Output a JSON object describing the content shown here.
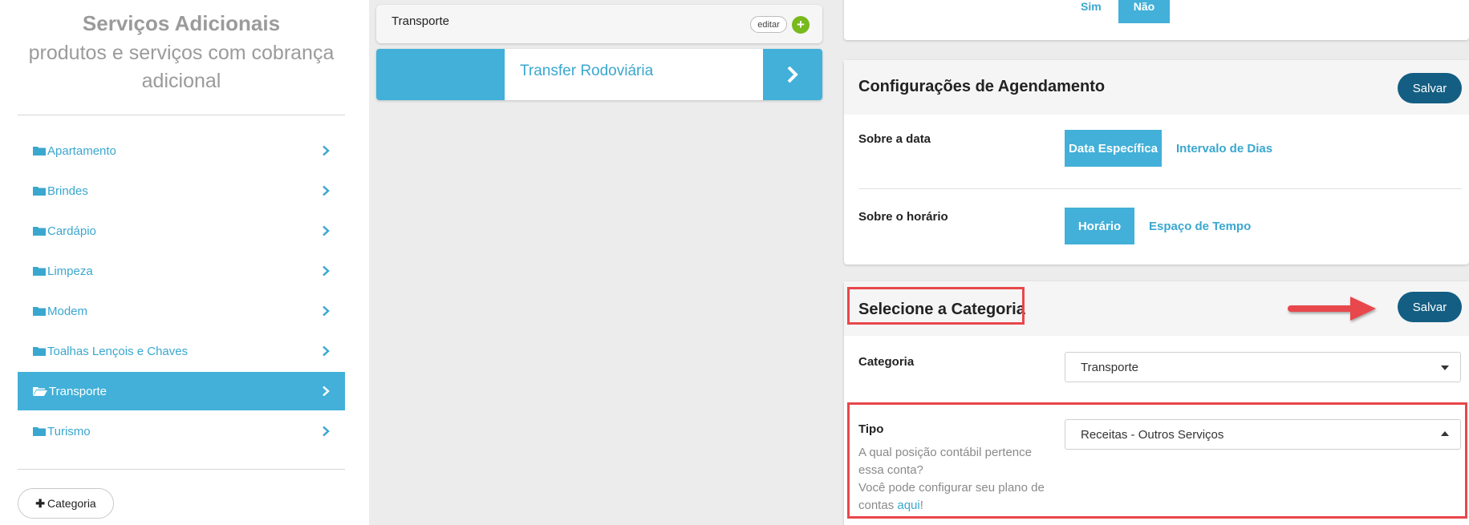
{
  "sidebar": {
    "title": "Serviços Adicionais",
    "subtitle_line1": "produtos e serviços com cobrança",
    "subtitle_line2": "adicional",
    "items": [
      {
        "label": "Apartamento"
      },
      {
        "label": "Brindes"
      },
      {
        "label": "Cardápio"
      },
      {
        "label": "Limpeza"
      },
      {
        "label": "Modem"
      },
      {
        "label": "Toalhas Lençois e Chaves"
      },
      {
        "label": "Transporte",
        "active": true
      },
      {
        "label": "Turismo"
      }
    ],
    "add_category_label": "Categoria"
  },
  "middle": {
    "category_card_title": "Transporte",
    "edit_label": "editar",
    "service_name": "Transfer Rodoviária"
  },
  "boolean_panel": {
    "yes_label": "Sim",
    "no_label": "Não",
    "selected": "Não"
  },
  "schedule_panel": {
    "title": "Configurações de Agendamento",
    "save_label": "Salvar",
    "date_label": "Sobre a data",
    "date_option_selected": "Data Específica",
    "date_option_other": "Intervalo de Dias",
    "time_label": "Sobre o horário",
    "time_option_selected": "Horário",
    "time_option_other": "Espaço de Tempo"
  },
  "category_panel": {
    "title": "Selecione a Categoria",
    "save_label": "Salvar",
    "category_label": "Categoria",
    "category_value": "Transporte",
    "type_label": "Tipo",
    "type_value": "Receitas - Outros Serviços",
    "help_line1": "A qual posição contábil pertence essa conta?",
    "help_line2_prefix": "Você pode configurar seu plano de contas ",
    "help_link": "aqui",
    "help_suffix": "!"
  },
  "colors": {
    "accent": "#42b0d8",
    "link": "#3aa7cf",
    "save_button": "#145e83",
    "add_green": "#78b91c",
    "annotation_red": "#e8474b"
  }
}
